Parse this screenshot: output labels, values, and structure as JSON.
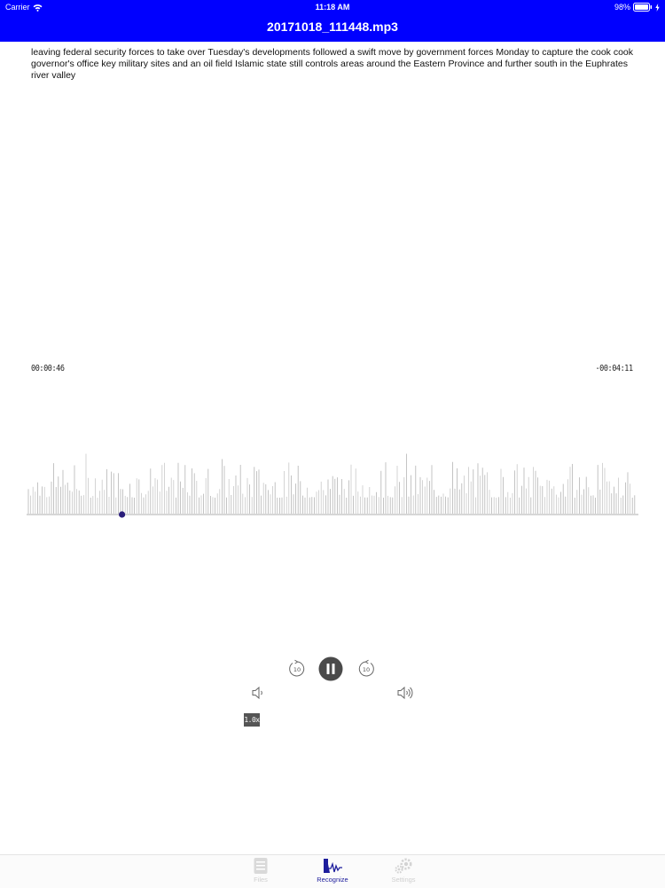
{
  "status_bar": {
    "carrier": "Carrier",
    "time": "11:18 AM",
    "battery": "98%",
    "icons": [
      "wifi-icon",
      "battery-icon",
      "charging-icon"
    ]
  },
  "header": {
    "title": "20171018_111448.mp3",
    "background_color": "#0000ff"
  },
  "transcript": {
    "text": "leaving federal security forces to take over Tuesday's developments followed a swift move by government forces Monday to capture the cook cook governor's office key military sites and an oil field Islamic state still controls areas around the Eastern Province and further south in the Euphrates river valley"
  },
  "player": {
    "elapsed": "00:00:46",
    "remaining": "-00:04:11",
    "progress_fraction": 0.156,
    "playhead_color": "#2a1d7a",
    "speed": "1.0x",
    "icons": [
      "rewind-10-icon",
      "pause-icon",
      "forward-10-icon",
      "volume-down-icon",
      "volume-up-icon"
    ]
  },
  "tab_bar": {
    "tabs": [
      {
        "label": "Files",
        "icon": "files-icon",
        "active": false
      },
      {
        "label": "Recognize",
        "icon": "recognize-icon",
        "active": true
      },
      {
        "label": "Settings",
        "icon": "gear-icon",
        "active": false
      }
    ],
    "active_color": "#1d1d9c",
    "inactive_color": "#cfcfcf"
  }
}
